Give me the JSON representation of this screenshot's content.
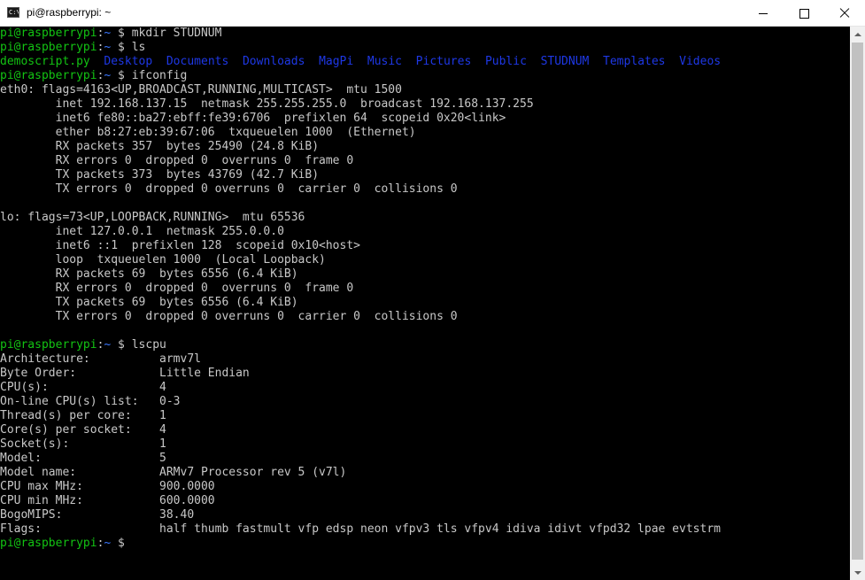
{
  "window": {
    "title": "pi@raspberrypi: ~",
    "icon": "C:\\",
    "controls": {
      "minimize": "minimize-icon",
      "maximize": "maximize-icon",
      "close": "close-icon"
    }
  },
  "colors": {
    "prompt_green": "#13c313",
    "path_blue": "#3b78ff",
    "dir_blue": "#1e38e6",
    "text": "#c0c0c0",
    "background": "#000000"
  },
  "terminal": {
    "lines": [
      {
        "segments": [
          {
            "t": "pi@raspberrypi",
            "c": "g"
          },
          {
            "t": ":",
            "c": "w"
          },
          {
            "t": "~",
            "c": "b"
          },
          {
            "t": " $ ",
            "c": "w"
          },
          {
            "t": "mkdir STUDNUM",
            "c": "w"
          }
        ]
      },
      {
        "segments": [
          {
            "t": "pi@raspberrypi",
            "c": "g"
          },
          {
            "t": ":",
            "c": "w"
          },
          {
            "t": "~",
            "c": "b"
          },
          {
            "t": " $ ",
            "c": "w"
          },
          {
            "t": "ls",
            "c": "w"
          }
        ]
      },
      {
        "segments": [
          {
            "t": "demoscript.py",
            "c": "g"
          },
          {
            "t": "  ",
            "c": "w"
          },
          {
            "t": "Desktop",
            "c": "bl"
          },
          {
            "t": "  ",
            "c": "w"
          },
          {
            "t": "Documents",
            "c": "bl"
          },
          {
            "t": "  ",
            "c": "w"
          },
          {
            "t": "Downloads",
            "c": "bl"
          },
          {
            "t": "  ",
            "c": "w"
          },
          {
            "t": "MagPi",
            "c": "bl"
          },
          {
            "t": "  ",
            "c": "w"
          },
          {
            "t": "Music",
            "c": "bl"
          },
          {
            "t": "  ",
            "c": "w"
          },
          {
            "t": "Pictures",
            "c": "bl"
          },
          {
            "t": "  ",
            "c": "w"
          },
          {
            "t": "Public",
            "c": "bl"
          },
          {
            "t": "  ",
            "c": "w"
          },
          {
            "t": "STUDNUM",
            "c": "bl"
          },
          {
            "t": "  ",
            "c": "w"
          },
          {
            "t": "Templates",
            "c": "bl"
          },
          {
            "t": "  ",
            "c": "w"
          },
          {
            "t": "Videos",
            "c": "bl"
          }
        ]
      },
      {
        "segments": [
          {
            "t": "pi@raspberrypi",
            "c": "g"
          },
          {
            "t": ":",
            "c": "w"
          },
          {
            "t": "~",
            "c": "b"
          },
          {
            "t": " $ ",
            "c": "w"
          },
          {
            "t": "ifconfig",
            "c": "w"
          }
        ]
      },
      {
        "segments": [
          {
            "t": "eth0: flags=4163<UP,BROADCAST,RUNNING,MULTICAST>  mtu 1500",
            "c": "w"
          }
        ]
      },
      {
        "segments": [
          {
            "t": "        inet 192.168.137.15  netmask 255.255.255.0  broadcast 192.168.137.255",
            "c": "w"
          }
        ]
      },
      {
        "segments": [
          {
            "t": "        inet6 fe80::ba27:ebff:fe39:6706  prefixlen 64  scopeid 0x20<link>",
            "c": "w"
          }
        ]
      },
      {
        "segments": [
          {
            "t": "        ether b8:27:eb:39:67:06  txqueuelen 1000  (Ethernet)",
            "c": "w"
          }
        ]
      },
      {
        "segments": [
          {
            "t": "        RX packets 357  bytes 25490 (24.8 KiB)",
            "c": "w"
          }
        ]
      },
      {
        "segments": [
          {
            "t": "        RX errors 0  dropped 0  overruns 0  frame 0",
            "c": "w"
          }
        ]
      },
      {
        "segments": [
          {
            "t": "        TX packets 373  bytes 43769 (42.7 KiB)",
            "c": "w"
          }
        ]
      },
      {
        "segments": [
          {
            "t": "        TX errors 0  dropped 0 overruns 0  carrier 0  collisions 0",
            "c": "w"
          }
        ]
      },
      {
        "segments": [
          {
            "t": "",
            "c": "w"
          }
        ]
      },
      {
        "segments": [
          {
            "t": "lo: flags=73<UP,LOOPBACK,RUNNING>  mtu 65536",
            "c": "w"
          }
        ]
      },
      {
        "segments": [
          {
            "t": "        inet 127.0.0.1  netmask 255.0.0.0",
            "c": "w"
          }
        ]
      },
      {
        "segments": [
          {
            "t": "        inet6 ::1  prefixlen 128  scopeid 0x10<host>",
            "c": "w"
          }
        ]
      },
      {
        "segments": [
          {
            "t": "        loop  txqueuelen 1000  (Local Loopback)",
            "c": "w"
          }
        ]
      },
      {
        "segments": [
          {
            "t": "        RX packets 69  bytes 6556 (6.4 KiB)",
            "c": "w"
          }
        ]
      },
      {
        "segments": [
          {
            "t": "        RX errors 0  dropped 0  overruns 0  frame 0",
            "c": "w"
          }
        ]
      },
      {
        "segments": [
          {
            "t": "        TX packets 69  bytes 6556 (6.4 KiB)",
            "c": "w"
          }
        ]
      },
      {
        "segments": [
          {
            "t": "        TX errors 0  dropped 0 overruns 0  carrier 0  collisions 0",
            "c": "w"
          }
        ]
      },
      {
        "segments": [
          {
            "t": "",
            "c": "w"
          }
        ]
      },
      {
        "segments": [
          {
            "t": "pi@raspberrypi",
            "c": "g"
          },
          {
            "t": ":",
            "c": "w"
          },
          {
            "t": "~",
            "c": "b"
          },
          {
            "t": " $ ",
            "c": "w"
          },
          {
            "t": "lscpu",
            "c": "w"
          }
        ]
      },
      {
        "segments": [
          {
            "t": "Architecture:          armv7l",
            "c": "w"
          }
        ]
      },
      {
        "segments": [
          {
            "t": "Byte Order:            Little Endian",
            "c": "w"
          }
        ]
      },
      {
        "segments": [
          {
            "t": "CPU(s):                4",
            "c": "w"
          }
        ]
      },
      {
        "segments": [
          {
            "t": "On-line CPU(s) list:   0-3",
            "c": "w"
          }
        ]
      },
      {
        "segments": [
          {
            "t": "Thread(s) per core:    1",
            "c": "w"
          }
        ]
      },
      {
        "segments": [
          {
            "t": "Core(s) per socket:    4",
            "c": "w"
          }
        ]
      },
      {
        "segments": [
          {
            "t": "Socket(s):             1",
            "c": "w"
          }
        ]
      },
      {
        "segments": [
          {
            "t": "Model:                 5",
            "c": "w"
          }
        ]
      },
      {
        "segments": [
          {
            "t": "Model name:            ARMv7 Processor rev 5 (v7l)",
            "c": "w"
          }
        ]
      },
      {
        "segments": [
          {
            "t": "CPU max MHz:           900.0000",
            "c": "w"
          }
        ]
      },
      {
        "segments": [
          {
            "t": "CPU min MHz:           600.0000",
            "c": "w"
          }
        ]
      },
      {
        "segments": [
          {
            "t": "BogoMIPS:              38.40",
            "c": "w"
          }
        ]
      },
      {
        "segments": [
          {
            "t": "Flags:                 half thumb fastmult vfp edsp neon vfpv3 tls vfpv4 idiva idivt vfpd32 lpae evtstrm",
            "c": "w"
          }
        ]
      },
      {
        "segments": [
          {
            "t": "pi@raspberrypi",
            "c": "g"
          },
          {
            "t": ":",
            "c": "w"
          },
          {
            "t": "~",
            "c": "b"
          },
          {
            "t": " $ ",
            "c": "w"
          }
        ]
      }
    ]
  }
}
